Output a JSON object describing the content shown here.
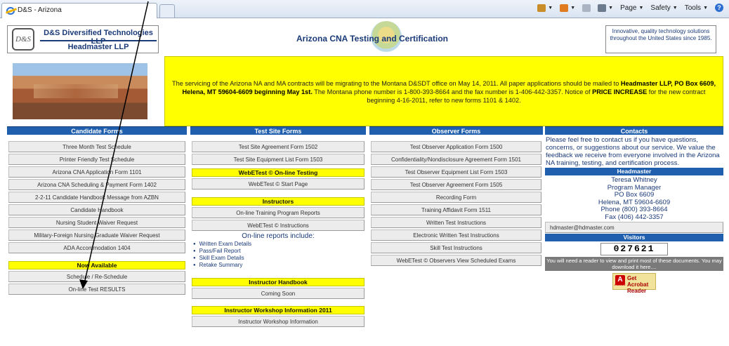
{
  "browser": {
    "tab_title": "D&S - Arizona",
    "cmd_page": "Page",
    "cmd_safety": "Safety",
    "cmd_tools": "Tools"
  },
  "header": {
    "company_line1": "D&S Diversified Technologies LLP",
    "company_line2": "Headmaster LLP",
    "logo_text": "D&S",
    "title": "Arizona CNA Testing and Certification",
    "tagline": "Innovative, quality technology solutions throughout the United States since 1985."
  },
  "notice": {
    "text_start": "The servicing of the Arizona NA and MA contracts will be migrating to the Montana D&SDT office on May 14, 2011. All paper applications should be mailed to ",
    "bold1": "Headmaster LLP, PO Box 6609, Helena, MT 59604-6609 beginning May 1st.",
    "text_mid": " The Montana phone number is 1-800-393-8664 and the fax number is 1-406-442-3357. Notice of ",
    "bold2": "PRICE INCREASE",
    "text_end": " for the new contract beginning 4-16-2011, refer to new forms 1101 & 1402."
  },
  "candidate": {
    "heading": "Candidate Forms",
    "buttons": [
      "Three Month Test Schedule",
      "Printer Friendly Test Schedule",
      "Arizona CNA Application Form 1101",
      "Arizona CNA Scheduling & Payment Form 1402",
      "2-2-11 Candidate Handbook Message from AZBN",
      "Candidate Handbook",
      "Nursing Student Waiver Request",
      "Military-Foreign Nursing Graduate Waiver Request",
      "ADA Accommodation 1404"
    ],
    "now_available": "Now Available",
    "schedule": "Schedule / Re-Schedule",
    "results": "On-line Test RESULTS"
  },
  "testsite": {
    "heading": "Test Site Forms",
    "agreement": "Test Site Agreement Form 1502",
    "equipment": "Test Site Equipment List Form 1503",
    "webetest_head": "WebETest © On-line Testing",
    "webetest_start": "WebETest © Start Page",
    "instructors_head": "Instructors",
    "training_reports": "On-line Training Program Reports",
    "webetest_instructions": "WebETest © Instructions",
    "reports_title": "On-line reports include:",
    "report_items": [
      "Written Exam Details",
      "Pass/Fail Report",
      "Skill Exam Details",
      "Retake Summary"
    ],
    "handbook_head": "Instructor Handbook",
    "coming_soon": "Coming Soon",
    "workshop_head": "Instructor Workshop Information 2011",
    "workshop_info": "Instructor Workshop Information"
  },
  "observer": {
    "heading": "Observer Forms",
    "buttons": [
      "Test Observer Application Form 1500",
      "Confidentiality/Nondisclosure Agreement Form 1501",
      "Test Observer Equipment List Form 1503",
      "Test Observer Agreement Form 1505",
      "Recording Form",
      "Training Affidavit Form 1511",
      "Written Test Instructions",
      "Electronic Written Test Instructions",
      "Skill Test Instructions",
      "WebETest © Observers View Scheduled Exams"
    ]
  },
  "contacts": {
    "heading": "Contacts",
    "intro": "Please feel free to contact us if you have questions, concerns, or suggestions about our service. We value the feedback we receive from everyone involved in the Arizona NA training, testing, and certification process.",
    "org_head": "Headmaster",
    "name": "Teresa Whitney",
    "role": "Program Manager",
    "box": "PO Box 6609",
    "city": "Helena, MT 59604-6609",
    "phone": "Phone (800) 393-8664",
    "fax": "Fax (406) 442-3357",
    "email": "hdmaster@hdmaster.com",
    "visitors_head": "Visitors",
    "visitor_count": "027621",
    "reader_note": "You will need a reader to view and print most of these documents. You may download it here....",
    "acrobat_line1": "Get Acrobat",
    "acrobat_line2": "Reader",
    "acrobat_adobe": "Adobe"
  }
}
